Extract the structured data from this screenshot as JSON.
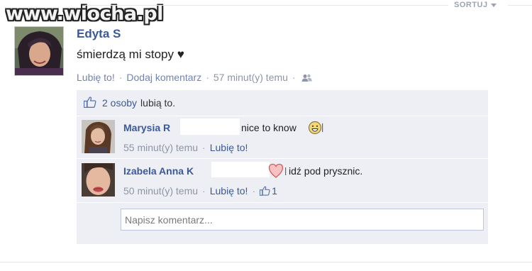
{
  "watermark": "www.wiocha.pl",
  "sort": {
    "label": "SORTUJ"
  },
  "post": {
    "author": "Edyta S",
    "text": "śmierdzą mi stopy ♥",
    "like_label": "Lubię to!",
    "comment_label": "Dodaj komentarz",
    "time": "57 minut(y) temu",
    "audience_icon": "friends-icon"
  },
  "likes": {
    "icon": "thumbs-up-icon",
    "count_text": "2 osoby",
    "rest_text": "lubią to."
  },
  "comments": [
    {
      "author": "Marysia R",
      "text": "nice to know",
      "emoticon": "smiley-icon",
      "time": "55 minut(y) temu",
      "like_label": "Lubię to!"
    },
    {
      "author": "Izabela Anna K",
      "text": "idź pod prysznic.",
      "emoticon": "heart-icon",
      "time": "50 minut(y) temu",
      "like_label": "Lubię to!",
      "likes_count": "1"
    }
  ],
  "comment_input": {
    "placeholder": "Napisz komentarz..."
  },
  "colors": {
    "link": "#3b5998",
    "meta": "#8d95a6",
    "panel": "#edeff4"
  }
}
